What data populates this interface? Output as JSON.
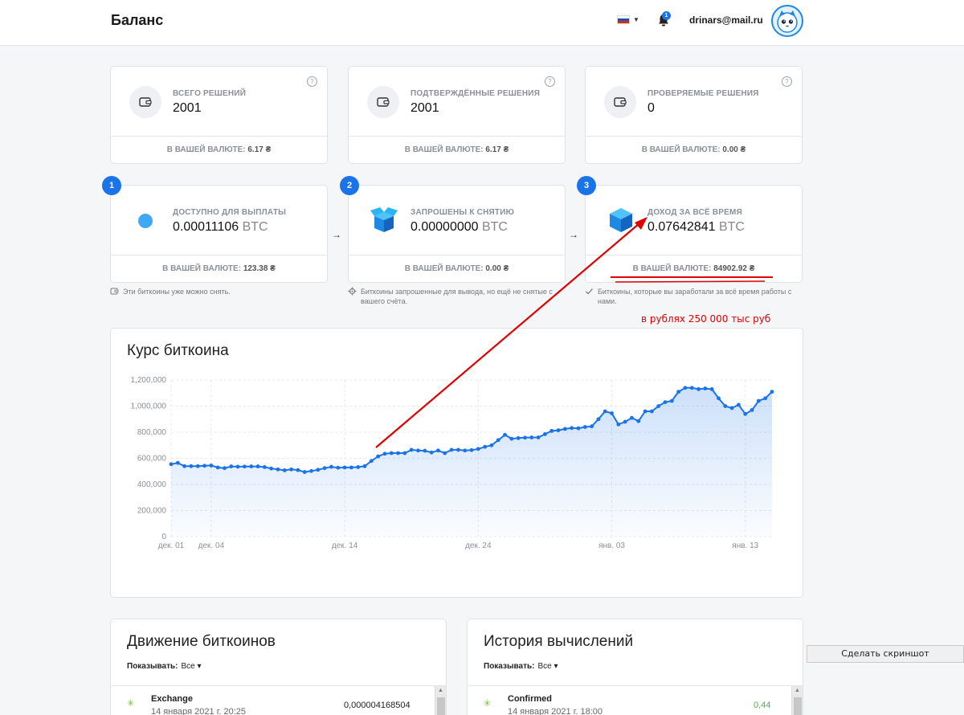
{
  "header": {
    "title": "Баланс",
    "email": "drinars@mail.ru",
    "notifications_count": "1"
  },
  "stats_row1": [
    {
      "label": "ВСЕГО РЕШЕНИЙ",
      "value": "2001",
      "foot_label": "В ВАШЕЙ ВАЛЮТЕ:",
      "foot_value": "6.17 ₴"
    },
    {
      "label": "ПОДТВЕРЖДЁННЫЕ РЕШЕНИЯ",
      "value": "2001",
      "foot_label": "В ВАШЕЙ ВАЛЮТЕ:",
      "foot_value": "6.17 ₴"
    },
    {
      "label": "ПРОВЕРЯЕМЫЕ РЕШЕНИЯ",
      "value": "0",
      "foot_label": "В ВАШЕЙ ВАЛЮТЕ:",
      "foot_value": "0.00 ₴"
    }
  ],
  "stats_row2": [
    {
      "step": "1",
      "label": "ДОСТУПНО ДЛЯ ВЫПЛАТЫ",
      "value": "0.00011106",
      "unit": "BTC",
      "foot_label": "В ВАШЕЙ ВАЛЮТЕ:",
      "foot_value": "123.38 ₴",
      "note": "Эти биткоины уже можно снять."
    },
    {
      "step": "2",
      "label": "ЗАПРОШЕНЫ К СНЯТИЮ",
      "value": "0.00000000",
      "unit": "BTC",
      "foot_label": "В ВАШЕЙ ВАЛЮТЕ:",
      "foot_value": "0.00 ₴",
      "note": "Биткоины запрошенные для вывода, но ещё не снятые с вашего счёта."
    },
    {
      "step": "3",
      "label": "ДОХОД ЗА ВСЁ ВРЕМЯ",
      "value": "0.07642841",
      "unit": "BTC",
      "foot_label": "В ВАШЕЙ ВАЛЮТЕ:",
      "foot_value": "84902.92 ₴",
      "note": "Биткоины, которые вы заработали за всё время работы с нами."
    }
  ],
  "annotation": {
    "text": "в рублях 250 000 тыс руб",
    "color": "#e00000"
  },
  "chart": {
    "title": "Курс биткоина"
  },
  "chart_data": {
    "type": "area",
    "title": "Курс биткоина",
    "xlabel": "",
    "ylabel": "",
    "ylim": [
      0,
      1200000
    ],
    "yticks": [
      "0",
      "200,000",
      "400,000",
      "600,000",
      "800,000",
      "1,000,000",
      "1,200,000"
    ],
    "xticks": [
      "дек. 01",
      "дек. 04",
      "дек. 14",
      "дек. 24",
      "янв. 03",
      "янв. 13"
    ],
    "xtick_days": [
      0,
      3,
      13,
      23,
      33,
      43
    ],
    "grid": true,
    "color": "#1a73e8",
    "x_days": [
      0,
      0.5,
      1,
      1.5,
      2,
      2.5,
      3,
      3.5,
      4,
      4.5,
      5,
      5.5,
      6,
      6.5,
      7,
      7.5,
      8,
      8.5,
      9,
      9.5,
      10,
      10.5,
      11,
      11.5,
      12,
      12.5,
      13,
      13.5,
      14,
      14.5,
      15,
      15.5,
      16,
      16.5,
      17,
      17.5,
      18,
      18.5,
      19,
      19.5,
      20,
      20.5,
      21,
      21.5,
      22,
      22.5,
      23,
      23.5,
      24,
      24.5,
      25,
      25.5,
      26,
      26.5,
      27,
      27.5,
      28,
      28.5,
      29,
      29.5,
      30,
      30.5,
      31,
      31.5,
      32,
      32.5,
      33,
      33.5,
      34,
      34.5,
      35,
      35.5,
      36,
      36.5,
      37,
      37.5,
      38,
      38.5,
      39,
      39.5,
      40,
      40.5,
      41,
      41.5,
      42,
      42.5,
      43,
      43.5,
      44,
      44.5,
      45
    ],
    "values": [
      555000,
      565000,
      540000,
      540000,
      540000,
      543000,
      545000,
      530000,
      525000,
      538000,
      536000,
      537000,
      538000,
      538000,
      533000,
      522000,
      515000,
      508000,
      515000,
      510000,
      495000,
      503000,
      512000,
      525000,
      535000,
      528000,
      530000,
      530000,
      533000,
      540000,
      580000,
      615000,
      635000,
      640000,
      640000,
      640000,
      665000,
      660000,
      658000,
      645000,
      660000,
      640000,
      665000,
      665000,
      660000,
      663000,
      672000,
      688000,
      700000,
      740000,
      780000,
      750000,
      755000,
      758000,
      760000,
      760000,
      785000,
      810000,
      815000,
      825000,
      832000,
      830000,
      840000,
      845000,
      900000,
      960000,
      945000,
      860000,
      880000,
      910000,
      885000,
      960000,
      960000,
      1000000,
      1030000,
      1040000,
      1110000,
      1140000,
      1140000,
      1130000,
      1135000,
      1130000,
      1060000,
      1000000,
      985000,
      1010000,
      940000,
      970000,
      1040000,
      1060000,
      1110000
    ]
  },
  "movements": {
    "title": "Движение биткоинов",
    "show_label": "Показывать:",
    "show_value": "Все",
    "rows": [
      {
        "name": "Exchange",
        "date": "14 января 2021 г. 20:25",
        "amount": "0,000004168504"
      }
    ]
  },
  "history": {
    "title": "История вычислений",
    "show_label": "Показывать:",
    "show_value": "Все",
    "rows": [
      {
        "name": "Confirmed",
        "date": "14 января 2021 г. 18:00",
        "amount": "0,44"
      }
    ]
  },
  "screenshot_button": "Сделать скриншот"
}
